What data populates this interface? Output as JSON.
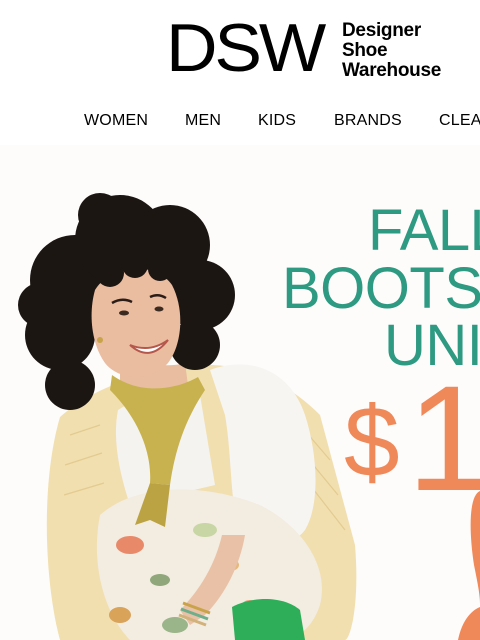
{
  "brand": {
    "mark": "DSW",
    "line1": "Designer",
    "line2": "Shoe",
    "line3": "Warehouse"
  },
  "nav": {
    "items": [
      "WOMEN",
      "MEN",
      "KIDS",
      "BRANDS",
      "CLEA"
    ]
  },
  "hero": {
    "line1": "FALL",
    "line2": "BOOTS",
    "line3": "UNI",
    "price_symbol": "$",
    "price_digits": "1",
    "colors": {
      "headline": "#2e9a82",
      "price": "#f0895a"
    }
  }
}
